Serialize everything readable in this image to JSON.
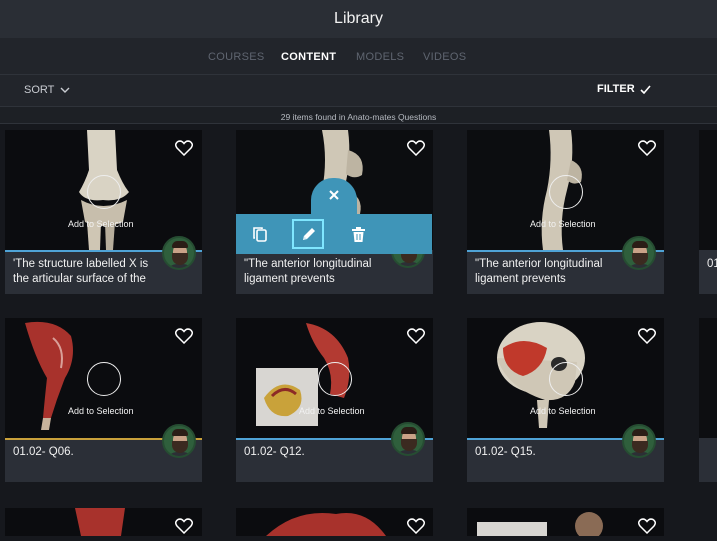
{
  "window": {
    "title": "Library"
  },
  "tabs": [
    {
      "label": "COURSES",
      "active": false
    },
    {
      "label": "CONTENT",
      "active": true
    },
    {
      "label": "MODELS",
      "active": false
    },
    {
      "label": "VIDEOS",
      "active": false
    }
  ],
  "toolbar": {
    "sort_label": "SORT",
    "filter_label": "FILTER"
  },
  "results": {
    "count_text": "29 items found in Anato-mates Questions"
  },
  "cards": [
    {
      "caption": "'The structure labelled X is the articular surface of the",
      "select_label": "Add to Selection"
    },
    {
      "caption": "\"The anterior longitudinal ligament prevents",
      "select_label": ""
    },
    {
      "caption": "\"The anterior longitudinal ligament prevents",
      "select_label": "Add to Selection"
    },
    {
      "caption": "01.02- Q06.",
      "select_label": "Add to Selection"
    },
    {
      "caption": "01.02- Q12.",
      "select_label": "Add to Selection"
    },
    {
      "caption": "01.02- Q15.",
      "select_label": "Add to Selection"
    },
    {
      "caption": "01",
      "select_label": ""
    },
    {
      "caption": "",
      "select_label": ""
    }
  ],
  "popup": {
    "actions": [
      "copy",
      "edit",
      "delete"
    ],
    "close_icon": "close-icon"
  },
  "colors": {
    "accent_blue": "#4fa3d6",
    "accent_gold": "#c9a13b",
    "popup_blue": "#3f95b8"
  }
}
